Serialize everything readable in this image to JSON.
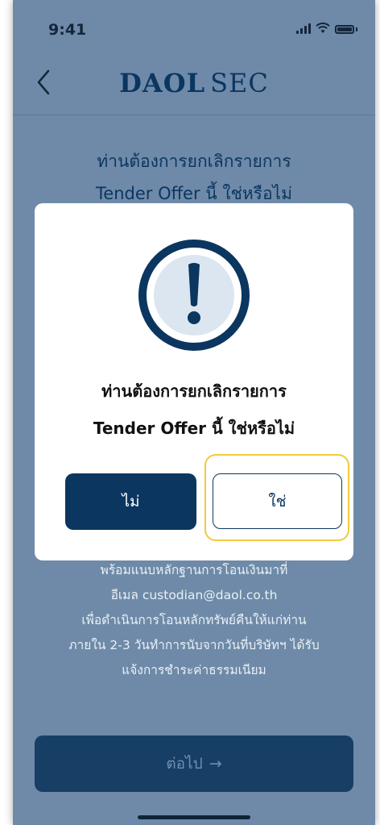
{
  "status_bar": {
    "time": "9:41"
  },
  "header": {
    "back_icon": "chevron-left-icon",
    "brand_primary": "DAOL",
    "brand_secondary": "SEC"
  },
  "background": {
    "title_line1": "ท่านต้องการยกเลิกรายการ",
    "title_line2": "Tender Offer นี้ ใช่หรือไม่",
    "body_lines": [
      "พร้อมแนบหลักฐานการโอนเงินมาที่",
      "อีเมล custodian@daol.co.th",
      "เพื่อดำเนินการโอนหลักทรัพย์คืนให้แก่ท่าน",
      "ภายใน 2-3 วันทำการนับจากวันที่บริษัทฯ ได้รับ",
      "แจ้งการชำระค่าธรรมเนียม"
    ],
    "next_button_label": "ต่อไป",
    "next_arrow": "→"
  },
  "modal": {
    "icon": "exclamation-alert-icon",
    "message_line1": "ท่านต้องการยกเลิกรายการ",
    "message_line2": "Tender Offer นี้ ใช่หรือไม่",
    "no_label": "ไม่",
    "yes_label": "ใช่"
  },
  "colors": {
    "overlay": "#6e8aa8",
    "primary": "#0b3660",
    "highlight": "#f3c93c"
  }
}
